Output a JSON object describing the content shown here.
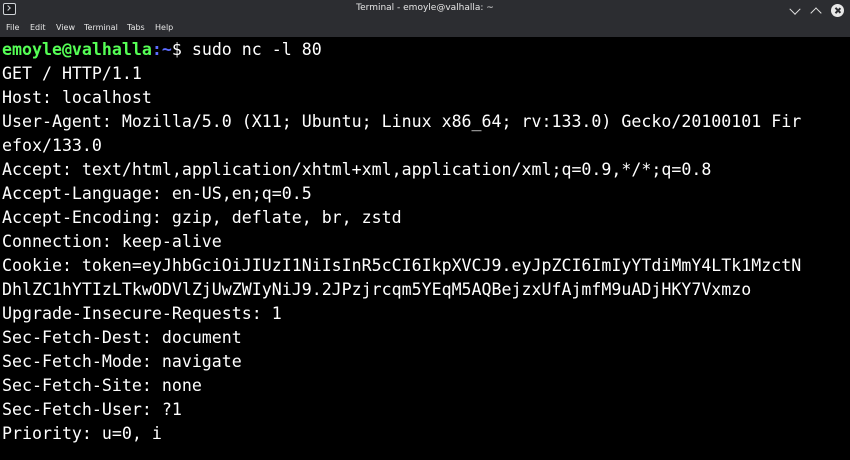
{
  "window": {
    "title": "Terminal - emoyle@valhalla: ~"
  },
  "menu": [
    "File",
    "Edit",
    "View",
    "Terminal",
    "Tabs",
    "Help"
  ],
  "icons": {
    "app": "terminal-icon",
    "minimize": "chevron-down-icon",
    "maximize": "chevron-up-icon",
    "close": "close-icon"
  },
  "prompt": {
    "user_host": "emoyle@valhalla",
    "path": ":~",
    "symbol": "$",
    "command": " sudo nc -l 80"
  },
  "output": [
    "GET / HTTP/1.1",
    "Host: localhost",
    "User-Agent: Mozilla/5.0 (X11; Ubuntu; Linux x86_64; rv:133.0) Gecko/20100101 Fir",
    "efox/133.0",
    "Accept: text/html,application/xhtml+xml,application/xml;q=0.9,*/*;q=0.8",
    "Accept-Language: en-US,en;q=0.5",
    "Accept-Encoding: gzip, deflate, br, zstd",
    "Connection: keep-alive",
    "Cookie: token=eyJhbGciOiJIUzI1NiIsInR5cCI6IkpXVCJ9.eyJpZCI6ImIyYTdiMmY4LTk1MzctN",
    "DhlZC1hYTIzLTkwODVlZjUwZWIyNiJ9.2JPzjrcqm5YEqM5AQBejzxUfAjmfM9uADjHKY7Vxmzo",
    "Upgrade-Insecure-Requests: 1",
    "Sec-Fetch-Dest: document",
    "Sec-Fetch-Mode: navigate",
    "Sec-Fetch-Site: none",
    "Sec-Fetch-User: ?1",
    "Priority: u=0, i"
  ],
  "colors": {
    "background": "#000000",
    "foreground": "#ffffff",
    "prompt_user": "#55ff55",
    "prompt_path": "#5c6cff",
    "chrome": "#2c2d31"
  }
}
